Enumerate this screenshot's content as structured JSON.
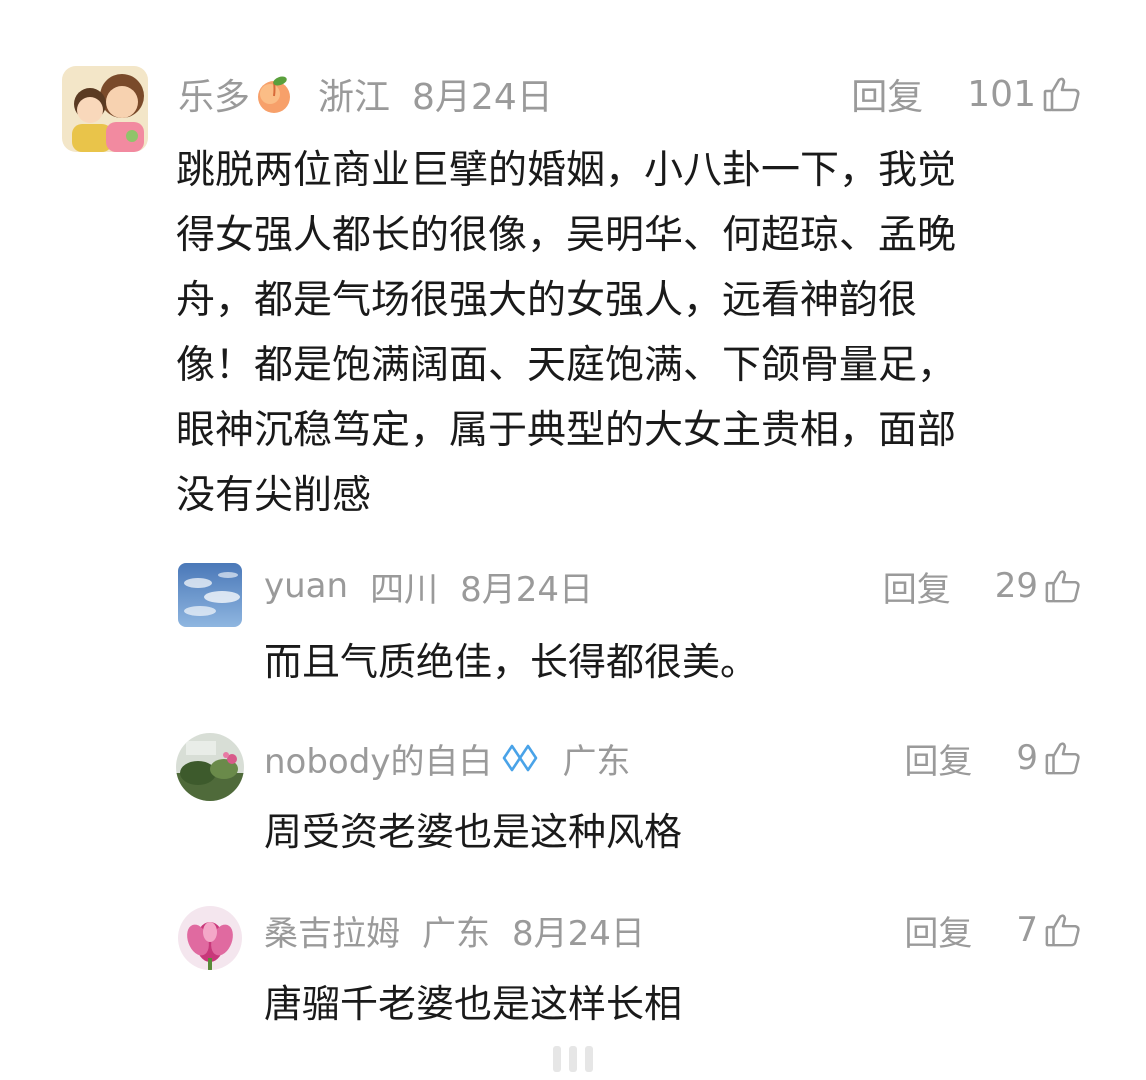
{
  "comments": [
    {
      "author": "乐多",
      "author_emoji": "peach-icon",
      "location": "浙江",
      "date": "8月24日",
      "reply_label": "回复",
      "likes": "101",
      "text": "跳脱两位商业巨擘的婚姻，小八卦一下，我觉\n得女强人都长的很像，吴明华、何超琼、孟晚\n舟，都是气场很强大的女强人，远看神韵很\n像！都是饱满阔面、天庭饱满、下颌骨量足，\n眼神沉稳笃定，属于典型的大女主贵相，面部\n没有尖削感"
    },
    {
      "author": "yuan",
      "location": "四川",
      "date": "8月24日",
      "reply_label": "回复",
      "likes": "29",
      "text": "而且气质绝佳，长得都很美。"
    },
    {
      "author": "nobody的自白",
      "author_badge": "vip-badge-icon",
      "location": "广东",
      "reply_label": "回复",
      "likes": "9",
      "text": "周受资老婆也是这种风格"
    },
    {
      "author": "桑吉拉姆",
      "location": "广东",
      "date": "8月24日",
      "reply_label": "回复",
      "likes": "7",
      "text": "唐骝千老婆也是这样长相"
    }
  ],
  "colors": {
    "meta_text": "#9a9a9a",
    "body_text": "#1a1a1a",
    "badge_blue": "#4aa3e8"
  }
}
